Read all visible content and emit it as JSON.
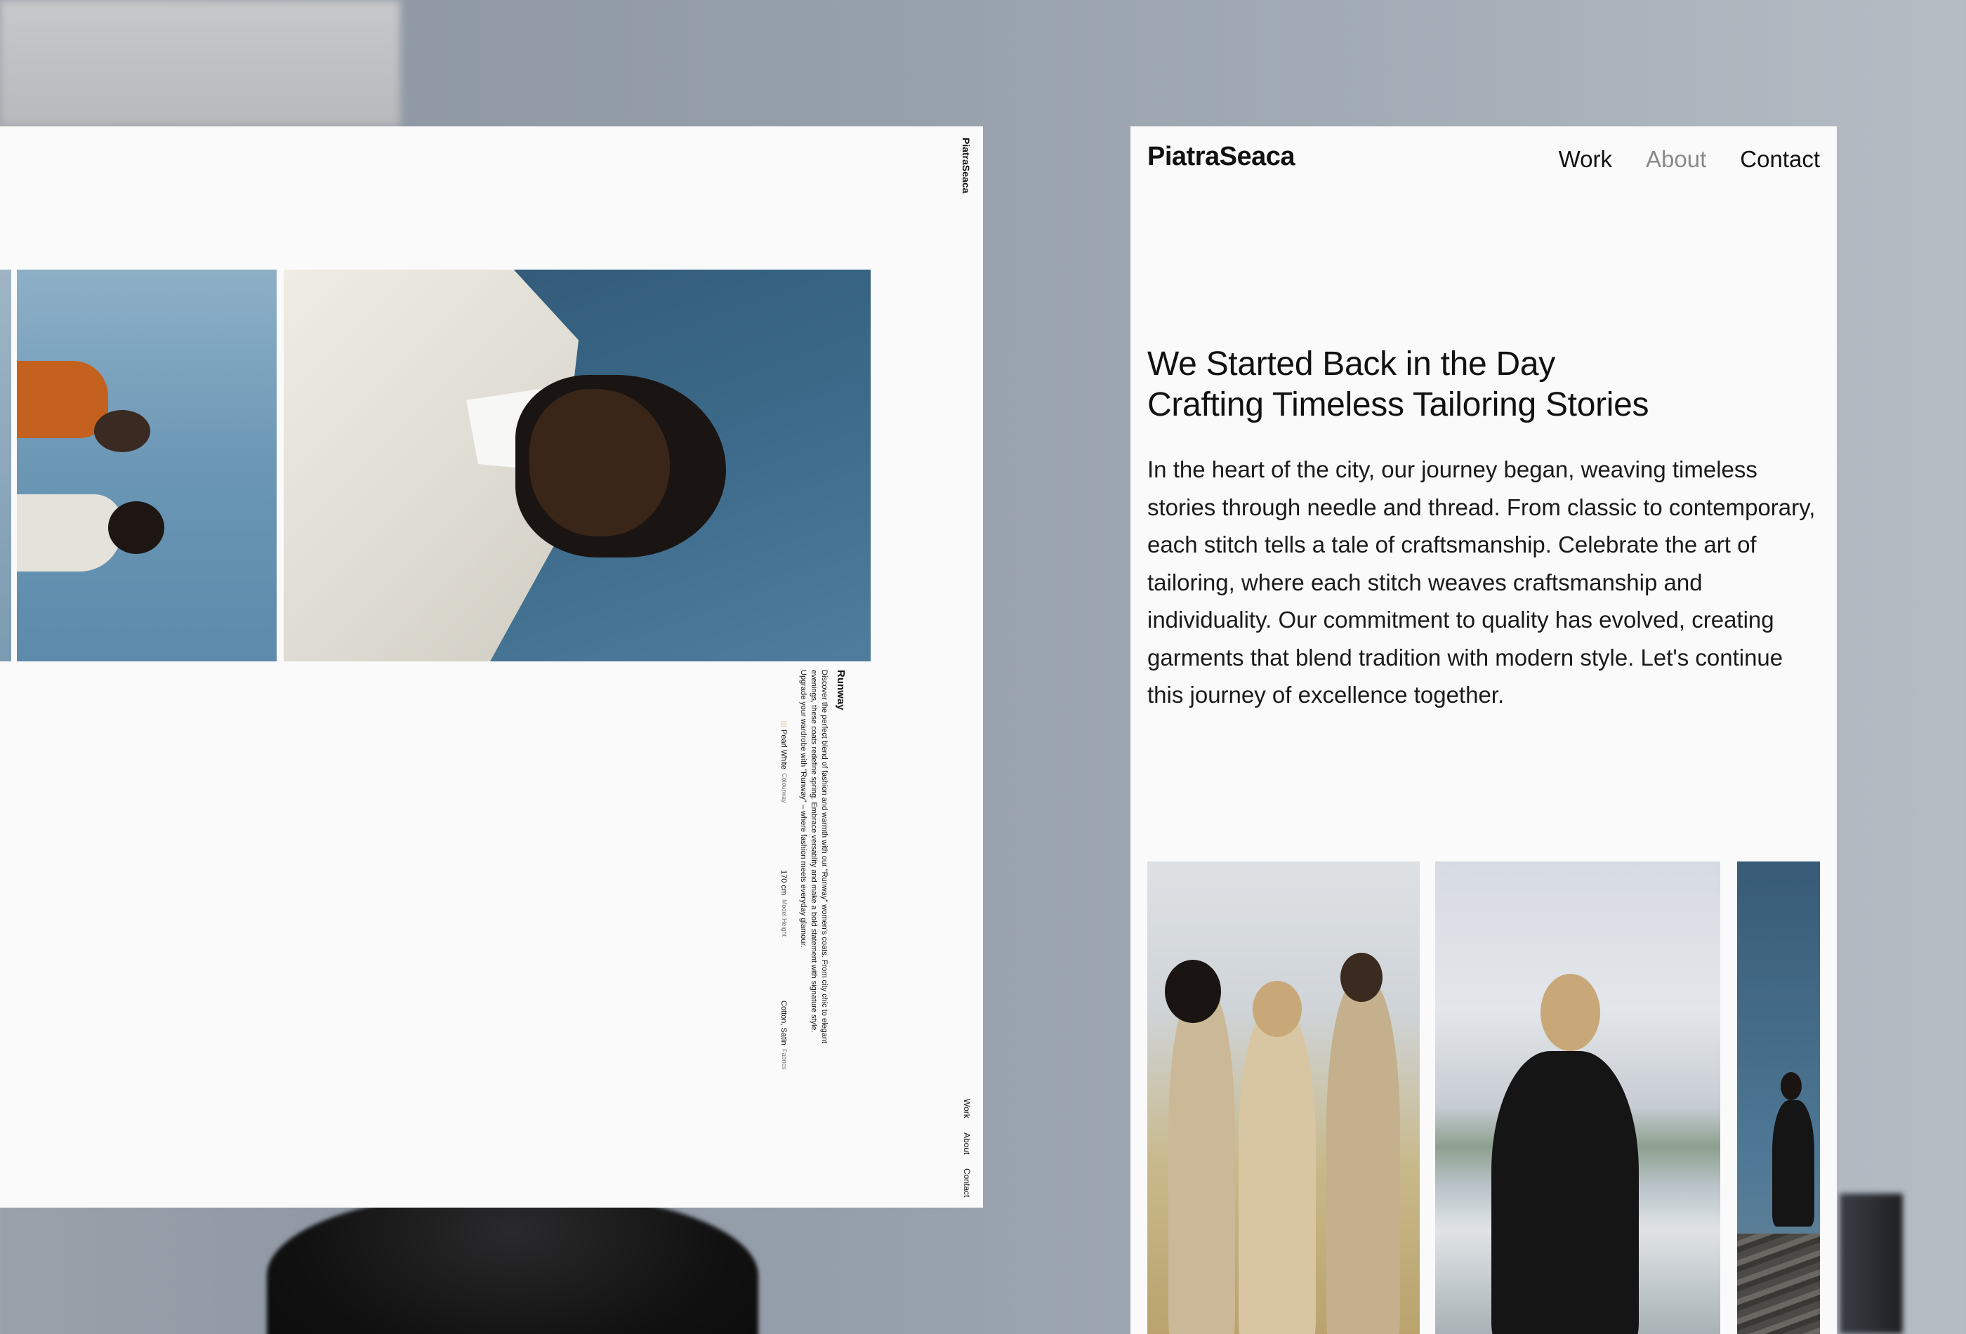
{
  "left_page": {
    "logo": "PiatraSeaca",
    "nav": [
      "Work",
      "About",
      "Contact"
    ],
    "product": {
      "title": "Runway",
      "description": "Discover the perfect blend of fashion and warmth with our \"Runway\" women's coats. From city chic to elegant evenings, these coats redefine spring. Embrace versatility and make a bold statement with signature style. Upgrade your wardrobe with \"Runway\" – where fashion meets everyday glamour.",
      "specs": [
        {
          "label": "Fabrics",
          "value": "Cotton, Satin"
        },
        {
          "label": "Model Height",
          "value": "170 cm"
        },
        {
          "label": "Colourway",
          "value": "Pearl White"
        }
      ]
    }
  },
  "right_page": {
    "logo": "PiatraSeaca",
    "nav": {
      "work": "Work",
      "about": "About",
      "contact": "Contact"
    },
    "headline_line1": "We Started Back in the Day",
    "headline_line2": "Crafting Timeless Tailoring Stories",
    "body": "In the heart of the city, our journey began, weaving timeless stories through needle and thread. From classic to contemporary, each stitch tells a tale of craftsmanship. Celebrate the art of tailoring, where each stitch weaves craftsmanship and individuality. Our commitment to quality has evolved, creating garments that blend tradition with modern style. Let's continue this journey of excellence together.",
    "active_nav": "About"
  },
  "colors": {
    "page_bg": "#fafafa",
    "text": "#111111",
    "nav_active": "#8a8a8a",
    "backdrop": "#96a0ab"
  }
}
